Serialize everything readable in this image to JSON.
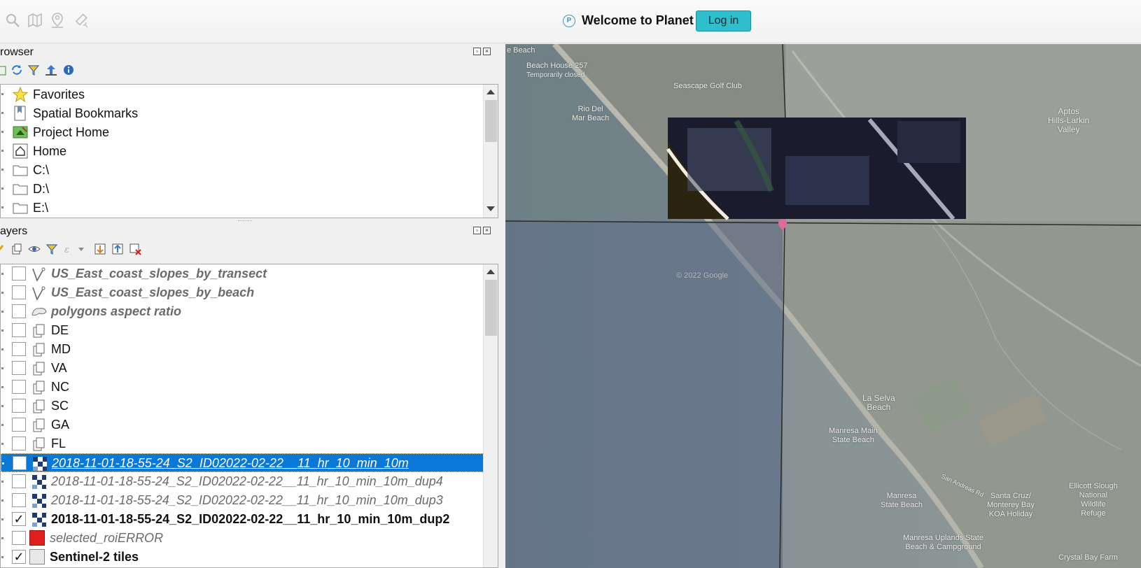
{
  "toolbar": {
    "icons": [
      "search-icon",
      "map-icon",
      "user-pin-icon",
      "satellite-icon"
    ],
    "welcome_text": "Welcome to Planet",
    "login_label": "Log in",
    "accent": "#2fbfcc"
  },
  "browser_panel": {
    "title": "rowser",
    "tool_icons": [
      "add-icon",
      "refresh-icon",
      "filter-icon",
      "collapse-icon",
      "info-icon"
    ],
    "items": [
      {
        "label": "Favorites",
        "icon": "star-icon"
      },
      {
        "label": "Spatial Bookmarks",
        "icon": "bookmark-icon"
      },
      {
        "label": "Project Home",
        "icon": "project-home-icon"
      },
      {
        "label": "Home",
        "icon": "home-icon"
      },
      {
        "label": "C:\\",
        "icon": "folder-icon"
      },
      {
        "label": "D:\\",
        "icon": "folder-icon"
      },
      {
        "label": "E:\\",
        "icon": "folder-icon"
      }
    ]
  },
  "layers_panel": {
    "title": "ayers",
    "tool_icons": [
      "style-icon",
      "add-group-icon",
      "visibility-icon",
      "filter-icon",
      "expression-icon",
      "expand-icon",
      "collapse-icon",
      "remove-icon"
    ],
    "items": [
      {
        "label": "US_East_coast_slopes_by_transect",
        "icon": "line-layer-icon",
        "checked": false,
        "style": "dim"
      },
      {
        "label": "US_East_coast_slopes_by_beach",
        "icon": "line-layer-icon",
        "checked": false,
        "style": "dim"
      },
      {
        "label": "polygons aspect ratio",
        "icon": "polygon-layer-icon",
        "checked": false,
        "style": "dim"
      },
      {
        "label": "DE",
        "icon": "group-layer-icon",
        "checked": false,
        "style": "normal"
      },
      {
        "label": "MD",
        "icon": "group-layer-icon",
        "checked": false,
        "style": "normal"
      },
      {
        "label": "VA",
        "icon": "group-layer-icon",
        "checked": false,
        "style": "normal"
      },
      {
        "label": "NC",
        "icon": "group-layer-icon",
        "checked": false,
        "style": "normal"
      },
      {
        "label": "SC",
        "icon": "group-layer-icon",
        "checked": false,
        "style": "normal"
      },
      {
        "label": "GA",
        "icon": "group-layer-icon",
        "checked": false,
        "style": "normal"
      },
      {
        "label": "FL",
        "icon": "group-layer-icon",
        "checked": false,
        "style": "normal"
      },
      {
        "label": "2018-11-01-18-55-24_S2_ID02022-02-22__11_hr_10_min_10m",
        "icon": "raster-layer-icon",
        "checked": false,
        "style": "selected"
      },
      {
        "label": "2018-11-01-18-55-24_S2_ID02022-02-22__11_hr_10_min_10m_dup4",
        "icon": "raster-layer-icon",
        "checked": false,
        "style": "ital"
      },
      {
        "label": "2018-11-01-18-55-24_S2_ID02022-02-22__11_hr_10_min_10m_dup3",
        "icon": "raster-layer-icon",
        "checked": false,
        "style": "ital"
      },
      {
        "label": "2018-11-01-18-55-24_S2_ID02022-02-22__11_hr_10_min_10m_dup2",
        "icon": "raster-layer-icon",
        "checked": true,
        "style": "bold"
      },
      {
        "label": "selected_roiERROR",
        "icon": "red-fill-icon",
        "checked": false,
        "style": "ital"
      },
      {
        "label": "Sentinel-2 tiles",
        "icon": "gray-fill-icon",
        "checked": true,
        "style": "bold"
      }
    ]
  },
  "map": {
    "labels": [
      {
        "text": "Beach House 257",
        "sub": "Temporarily closed"
      },
      {
        "text": "Seascape Golf Club"
      },
      {
        "text": "Rio Del\nMar Beach"
      },
      {
        "text": "Aptos\nHills-Larkin\nValley"
      },
      {
        "text": "© 2022 Google"
      },
      {
        "text": "La Selva\nBeach"
      },
      {
        "text": "Manresa Main\nState Beach"
      },
      {
        "text": "Manresa\nState Beach"
      },
      {
        "text": "Santa Cruz/\nMonterey Bay\nKOA Holiday"
      },
      {
        "text": "Ellicott Slough\nNational\nWildlife\nRefuge"
      },
      {
        "text": "Manresa Uplands State\nBeach & Campground"
      },
      {
        "text": "Crystal Bay Farm"
      },
      {
        "text": "San Andreas Rd"
      },
      {
        "text": "e Beach"
      }
    ]
  }
}
